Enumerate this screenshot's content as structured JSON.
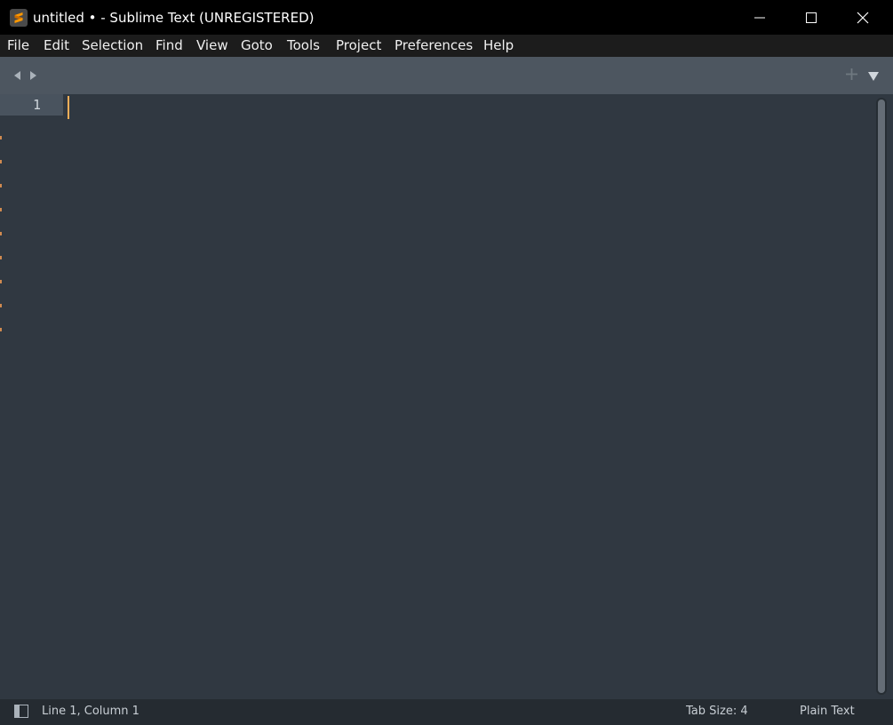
{
  "window": {
    "title": "untitled • - Sublime Text (UNREGISTERED)"
  },
  "icons": {
    "app": "sublime-text-logo-icon",
    "minimize": "minimize-icon",
    "maximize": "maximize-icon",
    "close": "close-icon",
    "tab_prev": "chevron-left-icon",
    "tab_next": "chevron-right-icon",
    "new_tab": "plus-icon",
    "tab_menu": "triangle-down-icon",
    "panel_toggle": "sidebar-toggle-icon"
  },
  "menu": {
    "items": [
      "File",
      "Edit",
      "Selection",
      "Find",
      "View",
      "Goto",
      "Tools",
      "Project",
      "Preferences",
      "Help"
    ]
  },
  "editor": {
    "line_numbers": [
      "1"
    ],
    "content": ""
  },
  "status": {
    "position": "Line 1, Column 1",
    "tab_size": "Tab Size: 4",
    "syntax": "Plain Text"
  },
  "colors": {
    "titlebar": "#000000",
    "menubar": "#1c1c1c",
    "tabstrip": "#4d5660",
    "editor_bg": "#303841",
    "gutter_highlight": "#49535e",
    "caret": "#f9ae58",
    "statusbar": "#252b31",
    "logo_orange": "#ff9800"
  }
}
